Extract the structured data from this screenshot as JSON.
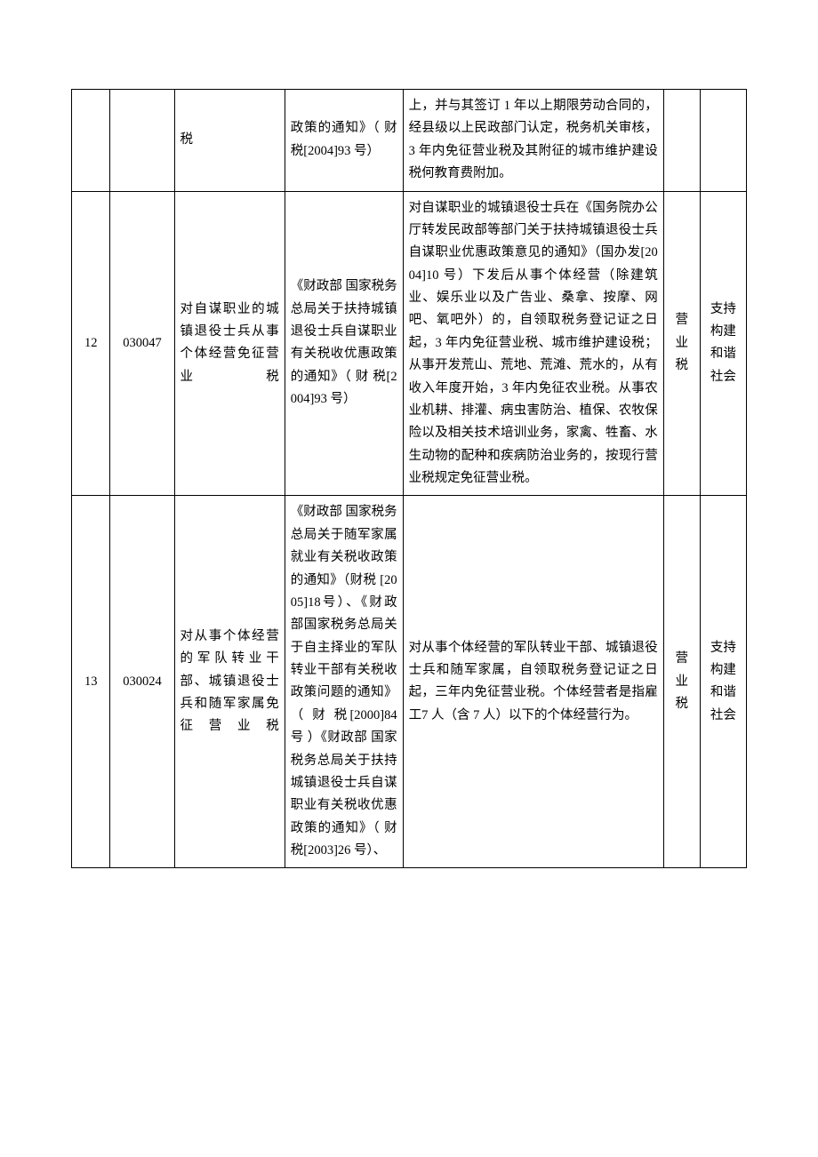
{
  "rows": [
    {
      "seq": "",
      "code": "",
      "name": "税",
      "basis": "政策的通知》（ 财 税[2004]93 号）",
      "desc": "上，并与其签订 1 年以上期限劳动合同的，经县级以上民政部门认定，税务机关审核，3 年内免征营业税及其附征的城市维护建设税何教育费附加。",
      "tax": "",
      "cat": ""
    },
    {
      "seq": "12",
      "code": "030047",
      "name": "对自谋职业的城镇退役士兵从事个体经营免征营业税",
      "basis": "《财政部 国家税务总局关于扶持城镇退役士兵自谋职业有关税收优惠政策的通知》（ 财 税[2004]93 号）",
      "desc": "对自谋职业的城镇退役士兵在《国务院办公厅转发民政部等部门关于扶持城镇退役士兵自谋职业优惠政策意见的通知》（国办发[2004]10 号）下发后从事个体经营（除建筑业、娱乐业以及广告业、桑拿、按摩、网吧、氧吧外）的，自领取税务登记证之日起，3 年内免征营业税、城市维护建设税；从事开发荒山、荒地、荒滩、荒水的，从有收入年度开始，3 年内免征农业税。从事农业机耕、排灌、病虫害防治、植保、农牧保险以及相关技术培训业务，家禽、牲畜、水生动物的配种和疾病防治业务的，按现行营业税规定免征营业税。",
      "tax": "营业税",
      "cat": "支持构建和谐社会"
    },
    {
      "seq": "13",
      "code": "030024",
      "name": "对从事个体经营的军队转业干部、城镇退役士兵和随军家属免征营业税",
      "basis": "《财政部 国家税务总局关于随军家属就业有关税收政策的通知》（财税 [2005]18号）、《财政部国家税务总局关于自主择业的军队转业干部有关税收政策问题的通知》（ 财 税[2000]84 号 ）《财政部 国家税务总局关于扶持城镇退役士兵自谋职业有关税收优惠政策的通知》（ 财 税[2003]26 号）、",
      "desc": "对从事个体经营的军队转业干部、城镇退役士兵和随军家属，自领取税务登记证之日起，三年内免征营业税。个体经营者是指雇工7 人（含 7 人）以下的个体经营行为。",
      "tax": "营业税",
      "cat": "支持构建和谐社会"
    }
  ]
}
